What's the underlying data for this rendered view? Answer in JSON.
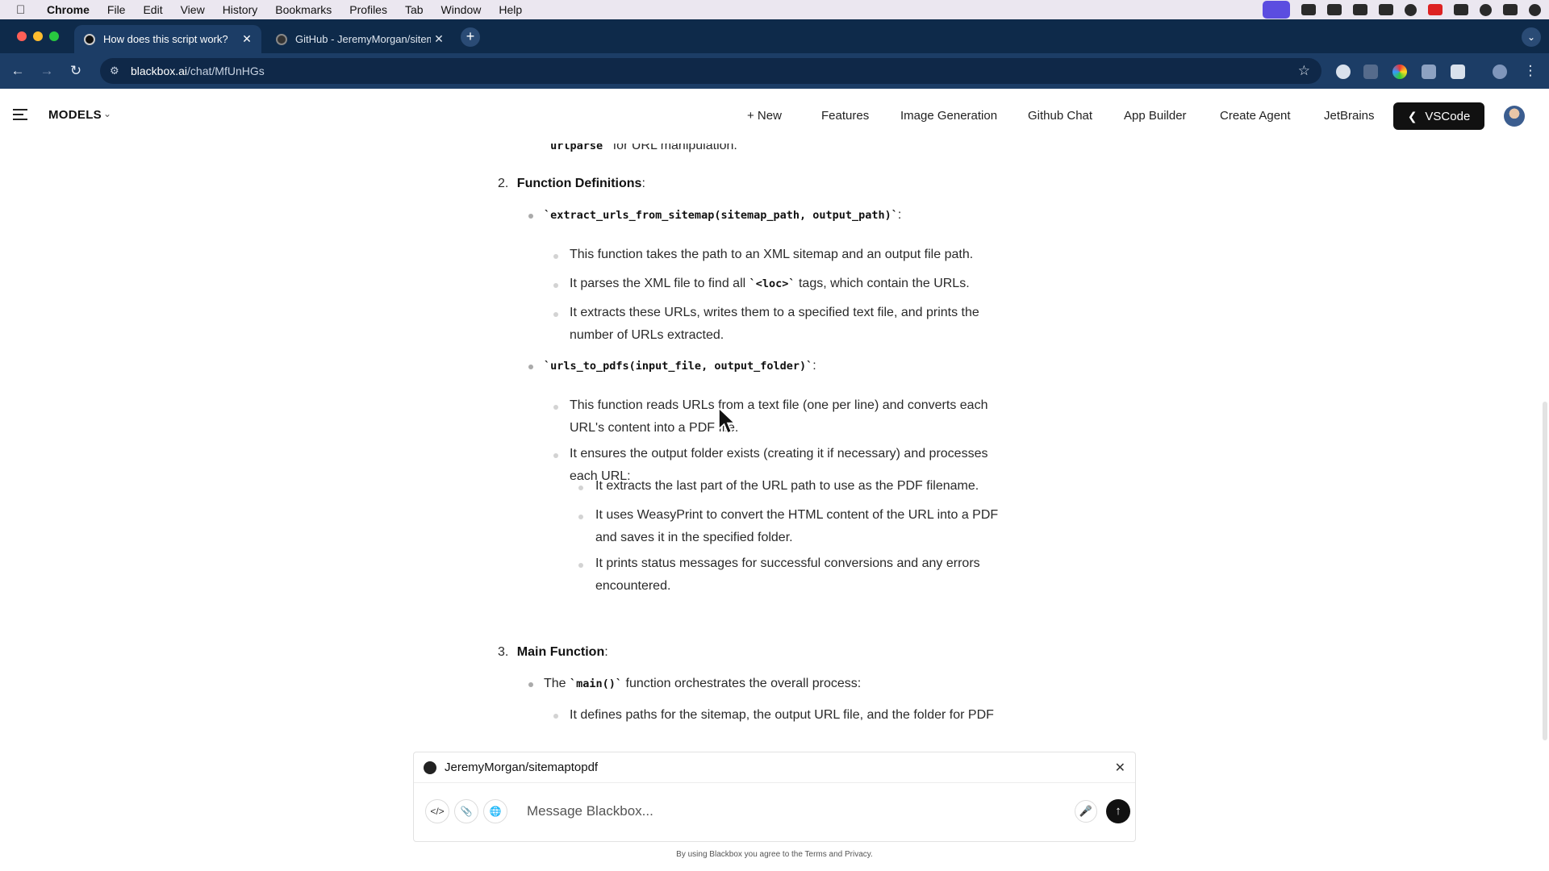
{
  "menubar": {
    "apple": "",
    "items": [
      "Chrome",
      "File",
      "Edit",
      "View",
      "History",
      "Bookmarks",
      "Profiles",
      "Tab",
      "Window",
      "Help"
    ]
  },
  "tabs": [
    {
      "title": "How does this script work?",
      "close": "✕"
    },
    {
      "title": "GitHub - JeremyMorgan/sitemaptopdf",
      "close": "✕"
    }
  ],
  "toolbar": {
    "url_host": "blackbox.ai",
    "url_path": "/chat/MfUnHGs"
  },
  "header": {
    "models_label": "MODELS",
    "nav": {
      "new": "+ New",
      "features": "Features",
      "image_generation": "Image Generation",
      "github_chat": "Github Chat",
      "app_builder": "App Builder",
      "create_agent": "Create Agent",
      "jetbrains": "JetBrains",
      "vscode": "VSCode"
    }
  },
  "content": {
    "l0_code": "`urlparse`",
    "l0_text": " for URL manipulation.",
    "s2_num": "2.",
    "s2_title": "Function Definitions",
    "colon": ":",
    "f1_sig": "`extract_urls_from_sitemap(sitemap_path, output_path)`",
    "f1_b1": "This function takes the path to an XML sitemap and an output file path.",
    "f1_b2_pre": "It parses the XML file to find all ",
    "f1_b2_code": "`<loc>`",
    "f1_b2_post": " tags, which contain the URLs.",
    "f1_b3_l1": "It extracts these URLs, writes them to a specified text file, and prints the",
    "f1_b3_l2": "number of URLs extracted.",
    "f2_sig": "`urls_to_pdfs(input_file, output_folder)`",
    "f2_b1_l1": "This function reads URLs from a text file (one per line) and converts each",
    "f2_b1_l2": "URL's content into a PDF file.",
    "f2_b2_l1": "It ensures the output folder exists (creating it if necessary) and processes",
    "f2_b2_l2": "each URL:",
    "f2_s1": "It extracts the last part of the URL path to use as the PDF filename.",
    "f2_s2_l1": "It uses WeasyPrint to convert the HTML content of the URL into a PDF",
    "f2_s2_l2": "and saves it in the specified folder.",
    "f2_s3_l1": "It prints status messages for successful conversions and any errors",
    "f2_s3_l2": "encountered.",
    "s3_num": "3.",
    "s3_title": "Main Function",
    "m_pre": "The ",
    "m_code": "`main()`",
    "m_post": " function orchestrates the overall process:",
    "m_b1": "It defines paths for the sitemap, the output URL file, and the folder for PDF"
  },
  "composer": {
    "repo": "JeremyMorgan/sitemaptopdf",
    "close": "✕",
    "placeholder": "Message Blackbox...",
    "terms": "By using Blackbox you agree to the Terms and Privacy."
  },
  "colors": {
    "tabstrip": "#0e2a4a",
    "toolbar": "#1c3d66",
    "vscode_button": "#111111",
    "menubar_highlight": "#5b4de0"
  }
}
